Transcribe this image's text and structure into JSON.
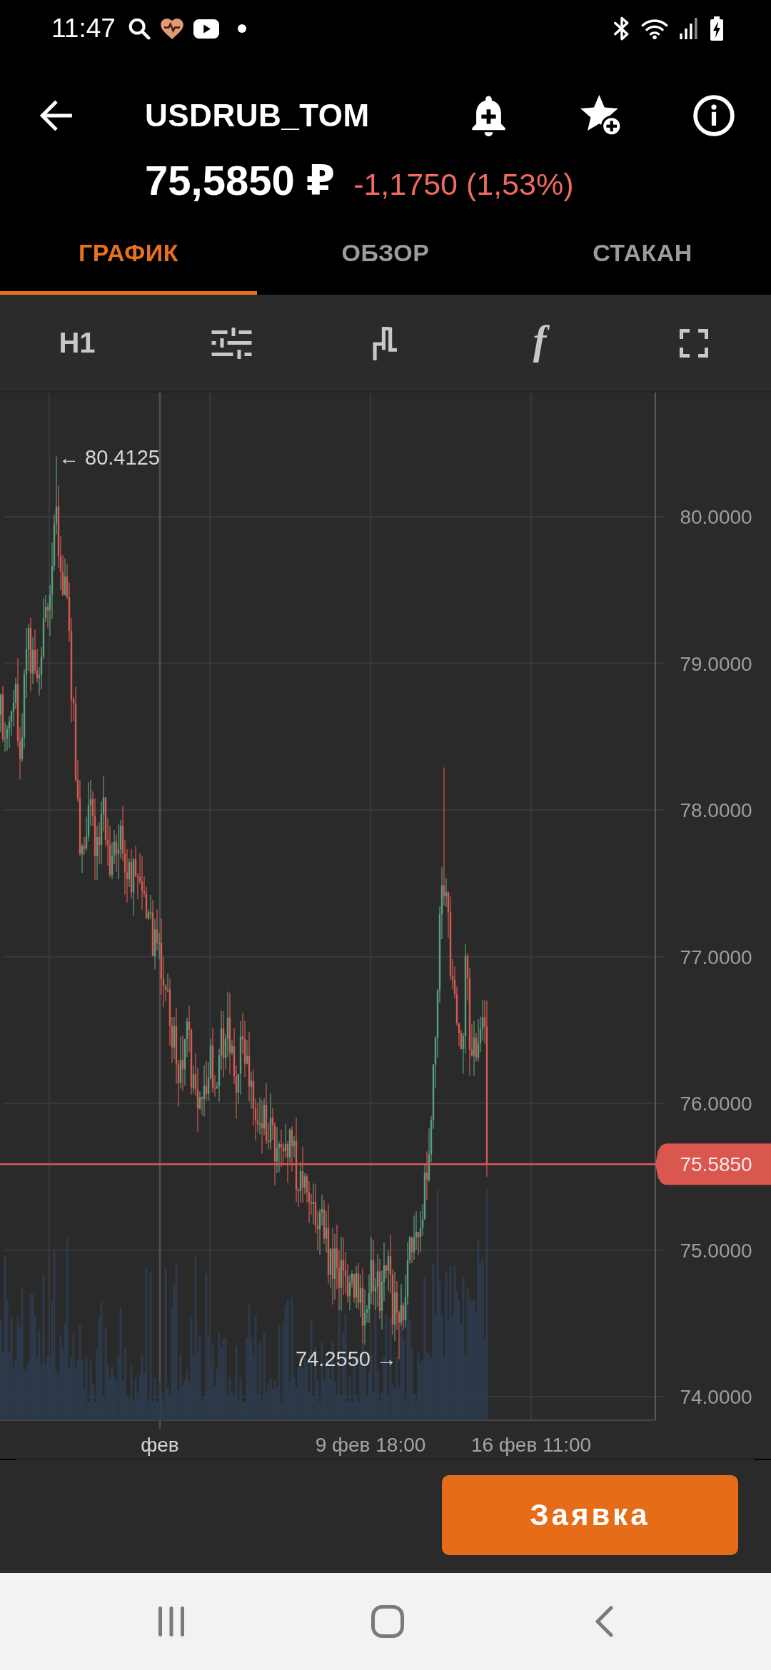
{
  "status_bar": {
    "time": "11:47"
  },
  "header": {
    "title": "USDRUB_TOM",
    "price": "75,5850 ₽",
    "change": "-1,1750 (1,53%)",
    "change_negative": true
  },
  "tabs": [
    {
      "label": "ГРАФИК",
      "selected": true
    },
    {
      "label": "ОБЗОР",
      "selected": false
    },
    {
      "label": "СТАКАН",
      "selected": false
    }
  ],
  "chart_toolbar": {
    "timeframe": "H1",
    "function_glyph": "f"
  },
  "chart": {
    "price_labels": [
      "80.0000",
      "79.0000",
      "78.0000",
      "77.0000",
      "76.0000",
      "75.0000",
      "74.0000"
    ],
    "time_labels": [
      {
        "label": "фев",
        "major": true
      },
      {
        "label": "9 фев 18:00",
        "major": false
      },
      {
        "label": "16 фев 11:00",
        "major": false
      }
    ],
    "high_label": "← 80.4125",
    "low_label": "74.2550 →",
    "last_price": "75.5850",
    "last_price_negative": true
  },
  "order_button": "Заявка"
}
